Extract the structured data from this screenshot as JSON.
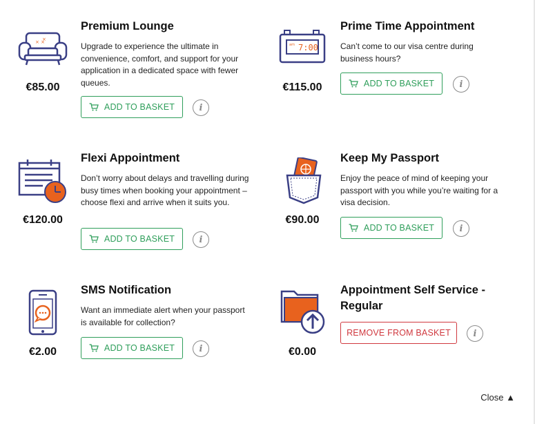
{
  "products": [
    {
      "title": "Premium Lounge",
      "description": "Upgrade to experience the ultimate in convenience, comfort, and support for your application in a dedicated space with fewer queues.",
      "price": "€85.00",
      "button_label": "ADD TO BASKET",
      "icon": "sofa-icon"
    },
    {
      "title": "Prime Time Appointment",
      "description": "Can’t come to our visa centre during business hours?",
      "price": "€115.00",
      "button_label": "ADD TO BASKET",
      "icon": "alarm-clock-icon",
      "clock_text": "7:00"
    },
    {
      "title": "Flexi Appointment",
      "description": "Don’t worry about delays and travelling during busy times when booking your appointment – choose flexi and arrive when it suits you.",
      "price": "€120.00",
      "button_label": "ADD TO BASKET",
      "icon": "calendar-clock-icon"
    },
    {
      "title": "Keep My Passport",
      "description": "Enjoy the peace of mind of keeping your passport with you while you’re waiting for a visa decision.",
      "price": "€90.00",
      "button_label": "ADD TO BASKET",
      "icon": "passport-pocket-icon"
    },
    {
      "title": "SMS Notification",
      "description": "Want an immediate alert when your passport is available for collection?",
      "price": "€2.00",
      "button_label": "ADD TO BASKET",
      "icon": "phone-message-icon"
    },
    {
      "title": "Appointment Self Service - Regular",
      "description": "",
      "price": "€0.00",
      "button_label": "REMOVE FROM BASKET",
      "icon": "folder-upload-icon"
    }
  ],
  "info_glyph": "i",
  "close_label": "Close ▲",
  "colors": {
    "accent_green": "#2e9e5a",
    "remove_red": "#d0383e",
    "navy": "#3a3f85",
    "orange": "#e8621e"
  }
}
